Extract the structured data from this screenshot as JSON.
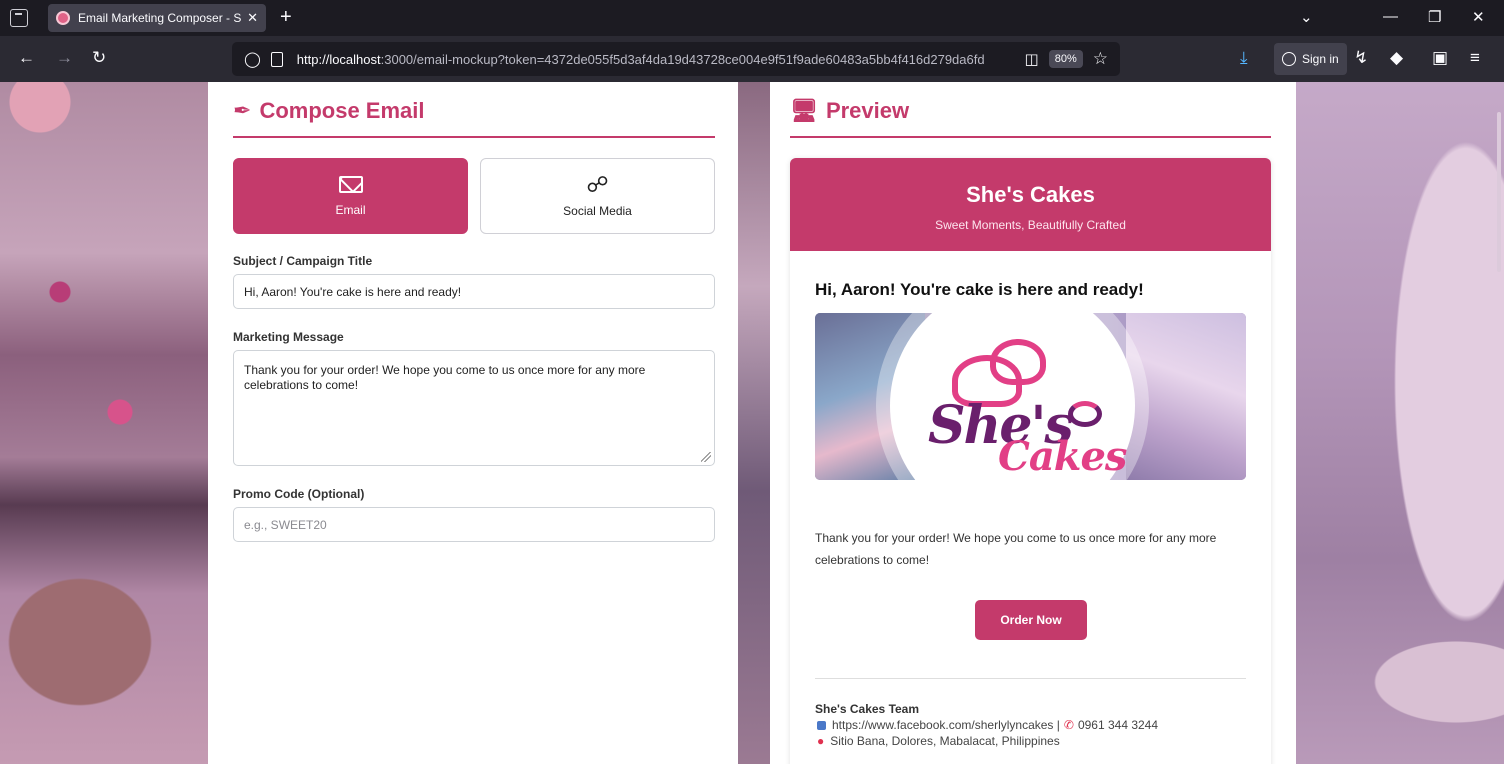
{
  "browser": {
    "tab_title": "Email Marketing Composer - Sh",
    "tab_close": "✕",
    "new_tab": "+",
    "url_host": "http://localhost",
    "url_rest": ":3000/email-mockup?token=4372de055f5d3af4da19d43728ce004e9f51f9ade60483a5bb4f416d279da6fd",
    "zoom": "80%",
    "sign_in": "Sign in"
  },
  "compose": {
    "title": "Compose Email",
    "types": [
      {
        "label": "Email",
        "icon": "envelope-icon",
        "active": true
      },
      {
        "label": "Social Media",
        "icon": "share-icon",
        "active": false
      }
    ],
    "subject_label": "Subject / Campaign Title",
    "subject_value": "Hi, Aaron! You're cake is here and ready!",
    "message_label": "Marketing Message",
    "message_value": "Thank you for your order! We hope you come to us once more for any more celebrations to come!",
    "promo_label": "Promo Code (Optional)",
    "promo_placeholder": "e.g., SWEET20"
  },
  "preview": {
    "title": "Preview",
    "brand": "She's Cakes",
    "tagline": "Sweet Moments, Beautifully Crafted",
    "subject": "Hi, Aaron! You're cake is here and ready!",
    "logo_top": "She's",
    "logo_bottom": "Cakes",
    "body": "Thank you for your order! We hope you come to us once more for any more celebrations to come!",
    "cta": "Order Now",
    "footer_team": "She's Cakes Team",
    "footer_facebook": "https://www.facebook.com/sherlylyncakes |",
    "footer_phone": "0961 344 3244",
    "footer_address": "Sitio Bana, Dolores, Mabalacat, Philippines"
  },
  "colors": {
    "accent": "#c43a6b",
    "browser_bg": "#2b2a33"
  }
}
